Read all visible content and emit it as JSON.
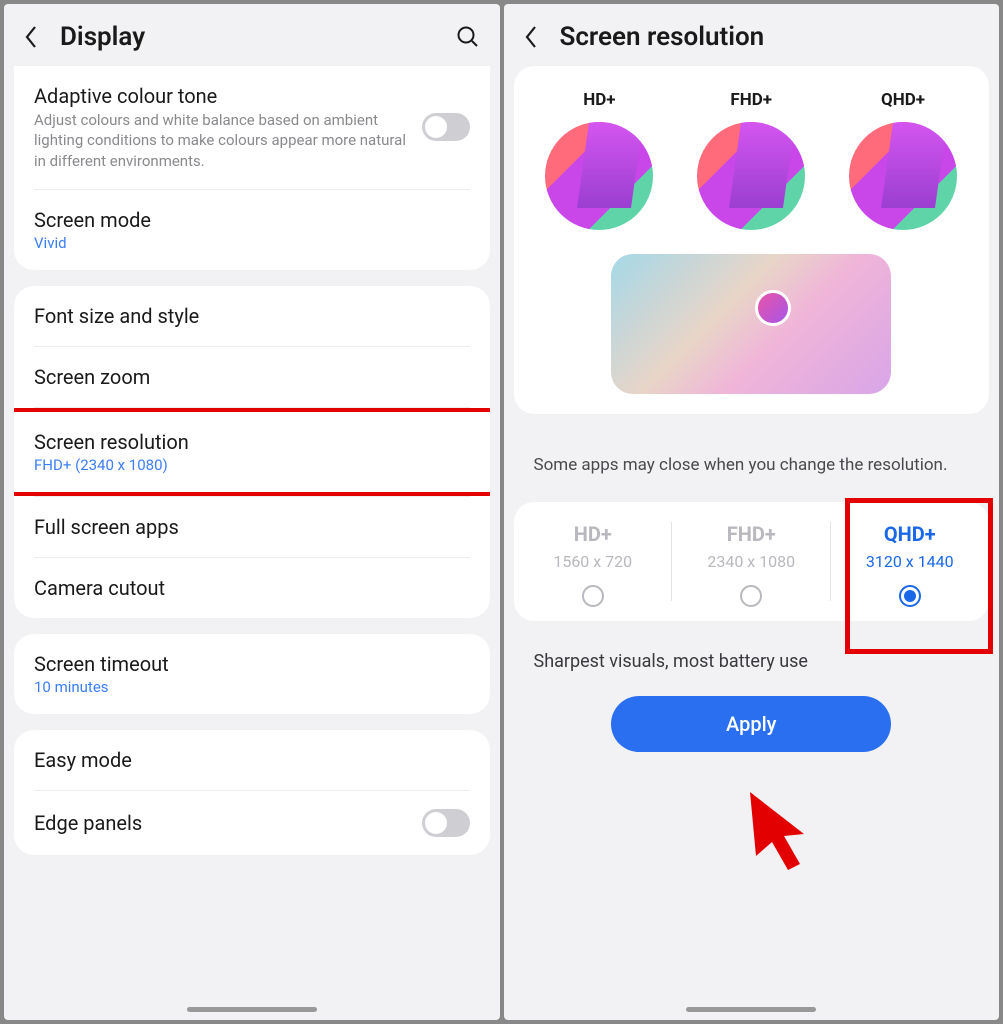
{
  "left": {
    "title": "Display",
    "adaptive": {
      "title": "Adaptive colour tone",
      "desc": "Adjust colours and white balance based on ambient lighting conditions to make colours appear more natural in different environments."
    },
    "screen_mode": {
      "title": "Screen mode",
      "value": "Vivid"
    },
    "font": "Font size and style",
    "zoom": "Screen zoom",
    "resolution": {
      "title": "Screen resolution",
      "value": "FHD+ (2340 x 1080)"
    },
    "full_screen": "Full screen apps",
    "camera_cutout": "Camera cutout",
    "timeout": {
      "title": "Screen timeout",
      "value": "10 minutes"
    },
    "easy_mode": "Easy mode",
    "edge_panels": "Edge panels"
  },
  "right": {
    "title": "Screen resolution",
    "previews": [
      "HD+",
      "FHD+",
      "QHD+"
    ],
    "info": "Some apps may close when you change the resolution.",
    "options": [
      {
        "name": "HD+",
        "res": "1560 x 720",
        "selected": false
      },
      {
        "name": "FHD+",
        "res": "2340 x 1080",
        "selected": false
      },
      {
        "name": "QHD+",
        "res": "3120 x 1440",
        "selected": true
      }
    ],
    "detail": "Sharpest visuals, most battery use",
    "apply": "Apply"
  }
}
